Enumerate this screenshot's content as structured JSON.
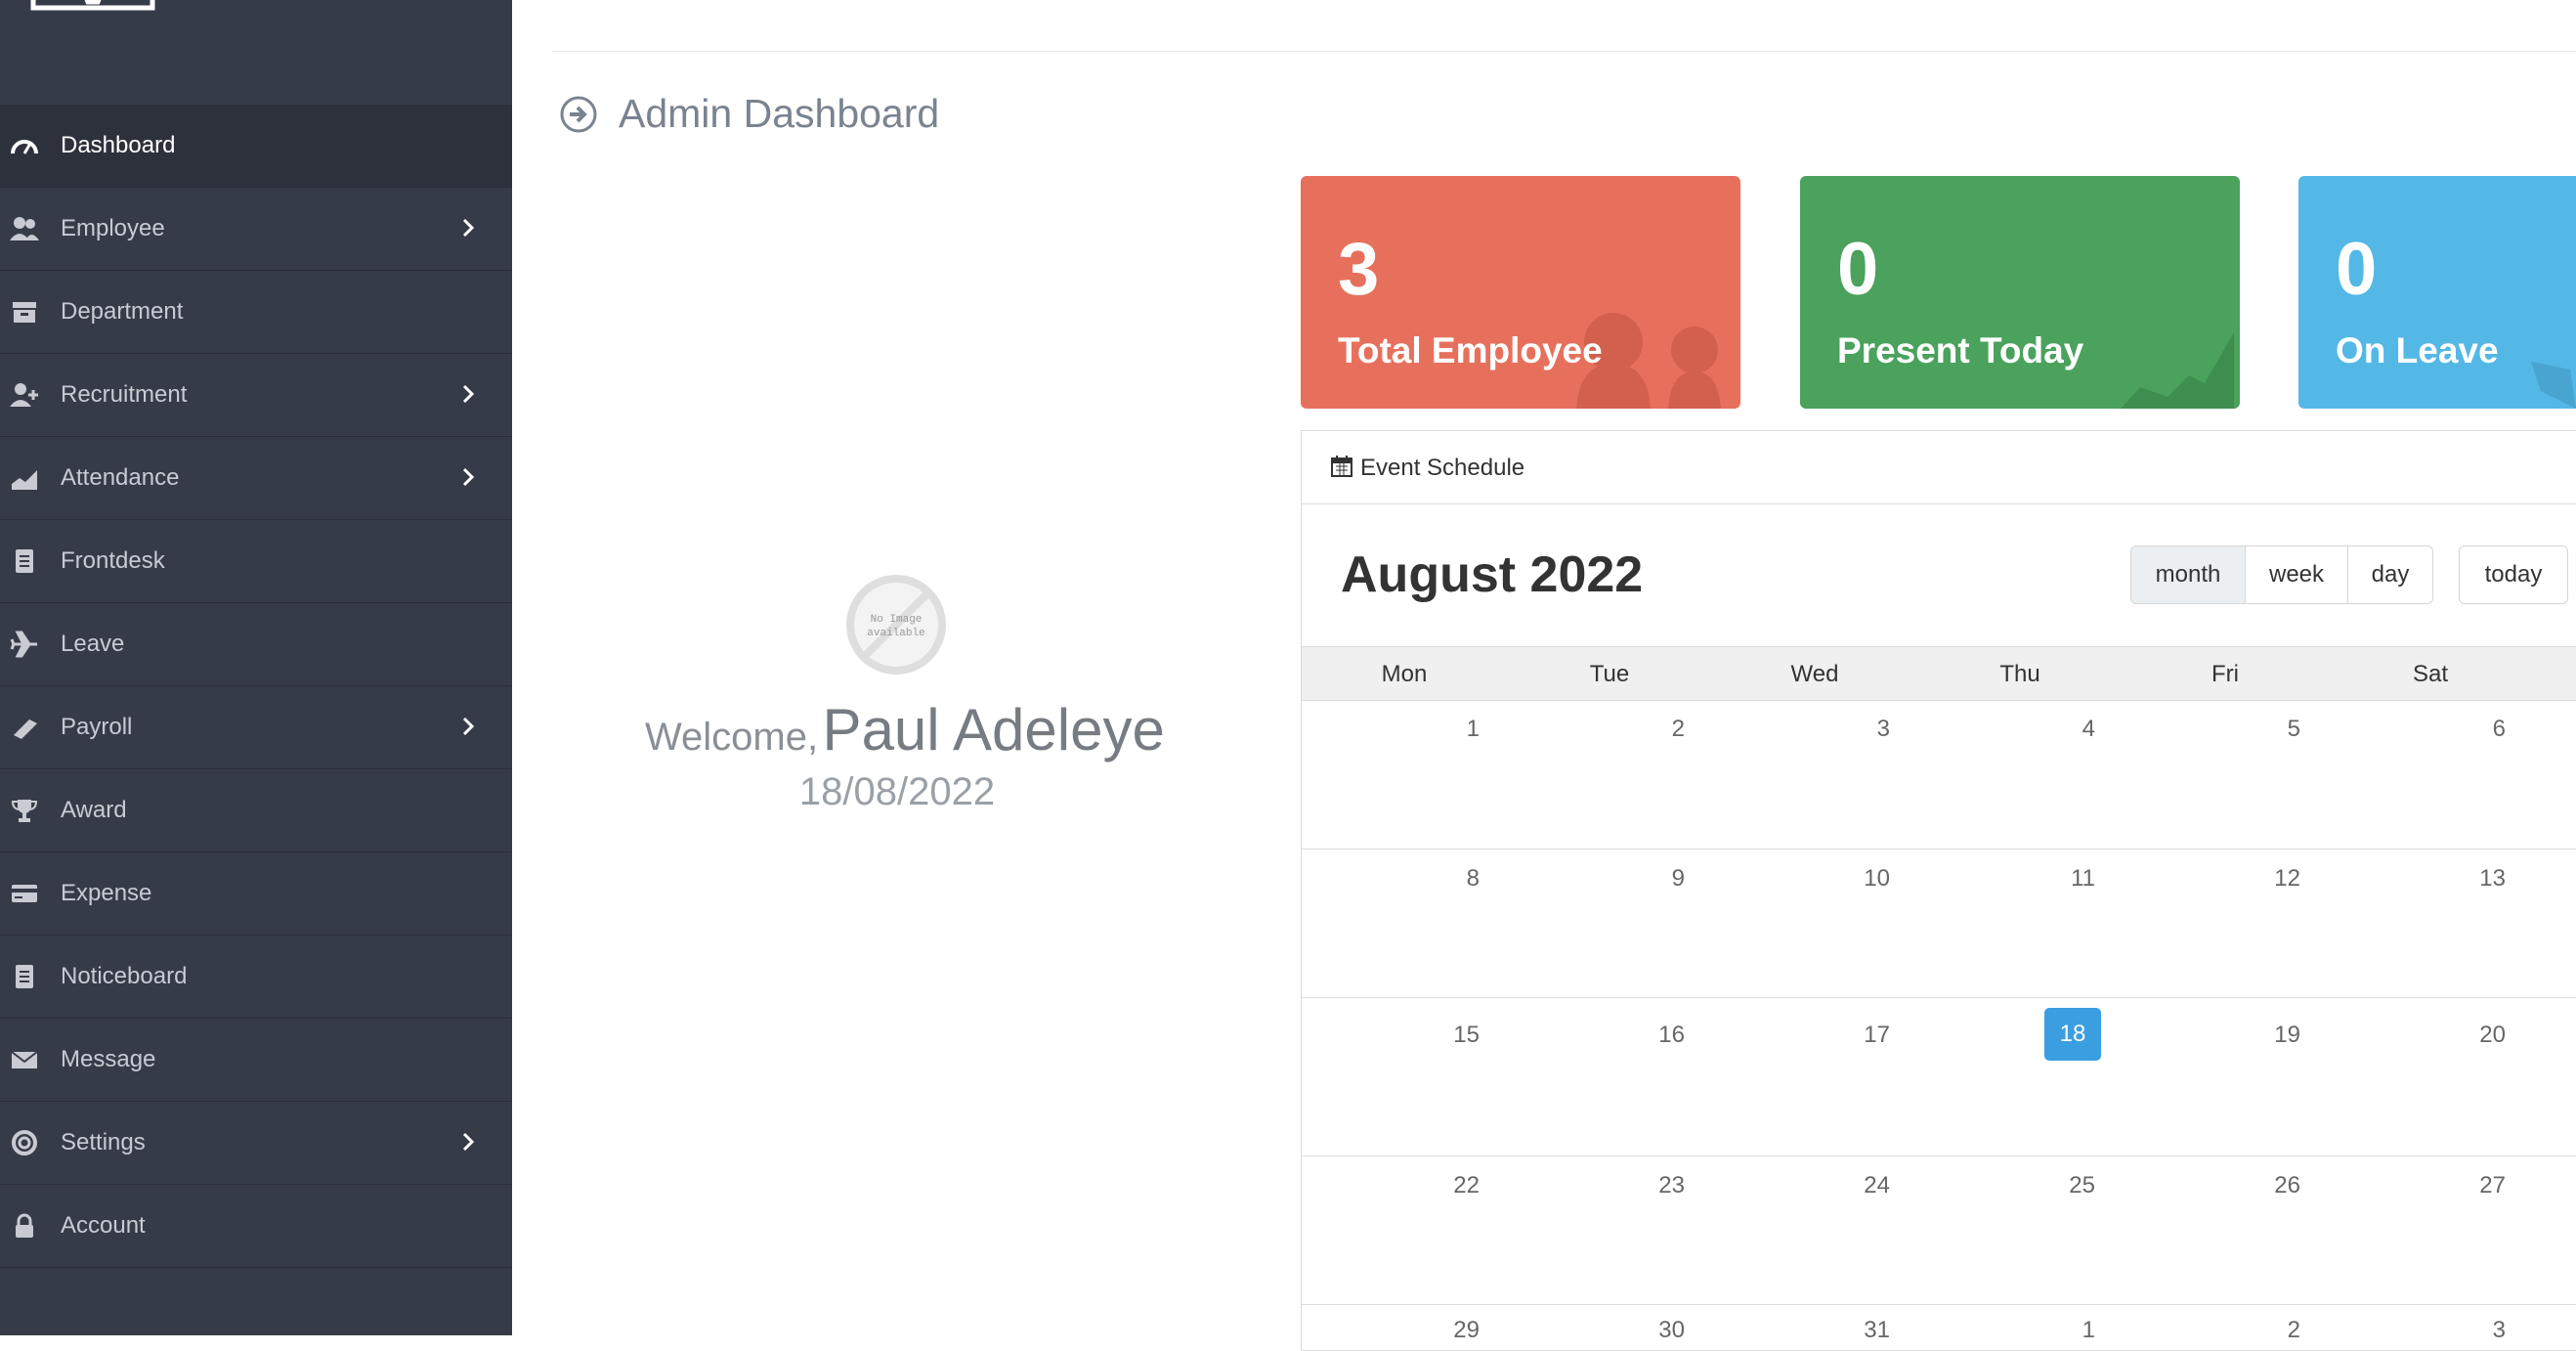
{
  "sidebar": {
    "items": [
      {
        "label": "Dashboard",
        "icon": "dashboard-gauge-icon",
        "active": true,
        "has_submenu": false
      },
      {
        "label": "Employee",
        "icon": "users-icon",
        "active": false,
        "has_submenu": true
      },
      {
        "label": "Department",
        "icon": "archive-box-icon",
        "active": false,
        "has_submenu": false
      },
      {
        "label": "Recruitment",
        "icon": "user-plus-icon",
        "active": false,
        "has_submenu": true
      },
      {
        "label": "Attendance",
        "icon": "area-chart-icon",
        "active": false,
        "has_submenu": true
      },
      {
        "label": "Frontdesk",
        "icon": "document-icon",
        "active": false,
        "has_submenu": false
      },
      {
        "label": "Leave",
        "icon": "plane-icon",
        "active": false,
        "has_submenu": false
      },
      {
        "label": "Payroll",
        "icon": "money-icon",
        "active": false,
        "has_submenu": true
      },
      {
        "label": "Award",
        "icon": "trophy-icon",
        "active": false,
        "has_submenu": false
      },
      {
        "label": "Expense",
        "icon": "credit-card-icon",
        "active": false,
        "has_submenu": false
      },
      {
        "label": "Noticeboard",
        "icon": "clipboard-icon",
        "active": false,
        "has_submenu": false
      },
      {
        "label": "Message",
        "icon": "envelope-icon",
        "active": false,
        "has_submenu": false
      },
      {
        "label": "Settings",
        "icon": "lifebuoy-icon",
        "active": false,
        "has_submenu": true
      },
      {
        "label": "Account",
        "icon": "lock-icon",
        "active": false,
        "has_submenu": false
      }
    ]
  },
  "header": {
    "title": "Admin Dashboard"
  },
  "profile": {
    "avatar_text": [
      "No Image",
      "available"
    ],
    "welcome_word": "Welcome,",
    "name": "Paul Adeleye",
    "date": "18/08/2022"
  },
  "stats": [
    {
      "value": "3",
      "label": "Total Employee",
      "color": "#e7705c"
    },
    {
      "value": "0",
      "label": "Present Today",
      "color": "#4aa25d"
    },
    {
      "value": "0",
      "label": "On Leave",
      "color": "#53b8e6"
    }
  ],
  "calendar": {
    "panel_title": "Event Schedule",
    "title": "August 2022",
    "views": [
      "month",
      "week",
      "day"
    ],
    "active_view": "month",
    "today_label": "today",
    "weekdays": [
      "Mon",
      "Tue",
      "Wed",
      "Thu",
      "Fri",
      "Sat"
    ],
    "weeks": [
      [
        "1",
        "2",
        "3",
        "4",
        "5",
        "6"
      ],
      [
        "8",
        "9",
        "10",
        "11",
        "12",
        "13"
      ],
      [
        "15",
        "16",
        "17",
        "18",
        "19",
        "20"
      ],
      [
        "22",
        "23",
        "24",
        "25",
        "26",
        "27"
      ],
      [
        "29",
        "30",
        "31",
        "1",
        "2",
        "3"
      ]
    ],
    "today": "18",
    "today_color": "#3a9ee0"
  }
}
